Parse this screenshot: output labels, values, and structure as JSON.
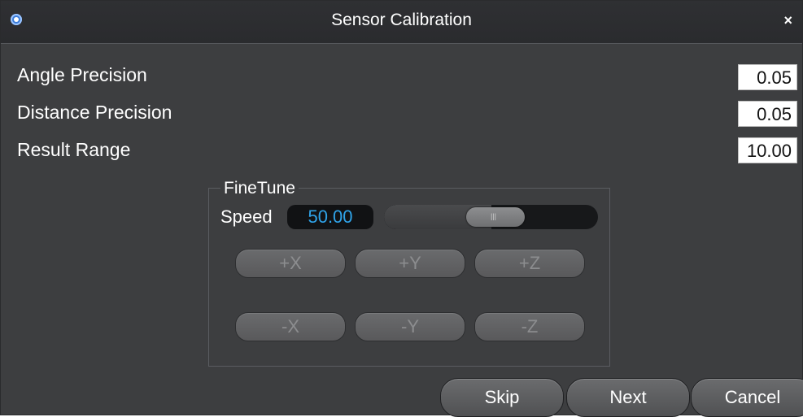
{
  "window": {
    "title": "Sensor Calibration",
    "close_label": "×",
    "app_icon": "calibration-app-icon"
  },
  "fields": [
    {
      "label": "Angle Precision",
      "value": "0.05"
    },
    {
      "label": "Distance Precision",
      "value": "0.05"
    },
    {
      "label": "Result Range",
      "value": "10.00"
    }
  ],
  "finetune": {
    "legend": "FineTune",
    "speed_label": "Speed",
    "speed_value": "50.00",
    "slider_value_fraction": 0.5,
    "buttons_row1": [
      "+X",
      "+Y",
      "+Z"
    ],
    "buttons_row2": [
      "-X",
      "-Y",
      "-Z"
    ]
  },
  "footer": {
    "skip": "Skip",
    "next": "Next",
    "cancel": "Cancel"
  },
  "colors": {
    "window_bg": "#3d3e40",
    "accent_value": "#2fa3e9"
  }
}
